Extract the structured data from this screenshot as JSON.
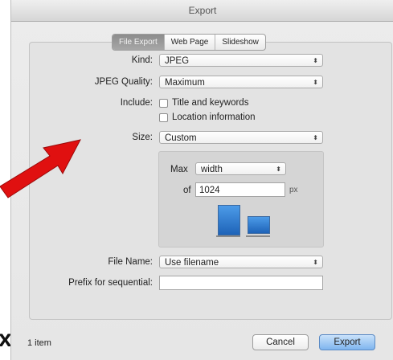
{
  "window": {
    "title": "Export"
  },
  "tabs": [
    {
      "label": "File Export",
      "active": true
    },
    {
      "label": "Web Page",
      "active": false
    },
    {
      "label": "Slideshow",
      "active": false
    }
  ],
  "form": {
    "kind_label": "Kind:",
    "kind_value": "JPEG",
    "quality_label": "JPEG Quality:",
    "quality_value": "Maximum",
    "include_label": "Include:",
    "include_title": "Title and keywords",
    "include_location": "Location information",
    "size_label": "Size:",
    "size_value": "Custom",
    "max_label": "Max",
    "max_value": "width",
    "of_label": "of",
    "of_value": "1024",
    "px_label": "px",
    "filename_label": "File Name:",
    "filename_value": "Use filename",
    "prefix_label": "Prefix for sequential:",
    "prefix_value": ""
  },
  "footer": {
    "item_count": "1 item",
    "cancel_label": "Cancel",
    "export_label": "Export",
    "cropped_text": "x."
  },
  "icons": {
    "popup_arrows": "⬍",
    "arrow_color": "#e01010",
    "accent": "#2a7fd6"
  }
}
